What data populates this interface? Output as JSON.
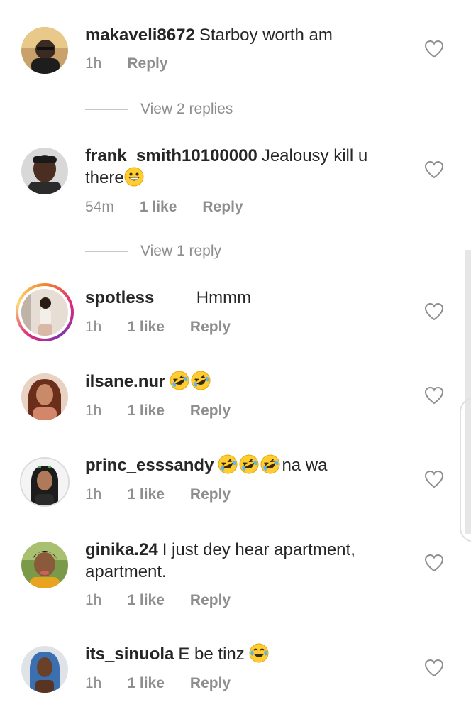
{
  "comments": [
    {
      "username": "makaveli8672",
      "text": "Starboy worth am",
      "time": "1h",
      "likes": "",
      "reply": "Reply",
      "view_replies": "View 2 replies"
    },
    {
      "username": "frank_smith10100000",
      "text": "Jealousy kill u there",
      "emoji": "grinning-face",
      "time": "54m",
      "likes": "1 like",
      "reply": "Reply",
      "view_replies": "View 1 reply"
    },
    {
      "username": "spotless____",
      "text": "Hmmm",
      "time": "1h",
      "likes": "1 like",
      "reply": "Reply"
    },
    {
      "username": "ilsane.nur",
      "text": "",
      "emoji": "rolling-on-floor-laughing x2",
      "time": "1h",
      "likes": "1 like",
      "reply": "Reply"
    },
    {
      "username": "princ_esssandy",
      "text": "na wa",
      "emoji": "rolling-on-floor-laughing x3",
      "time": "1h",
      "likes": "1 like",
      "reply": "Reply"
    },
    {
      "username": "ginika.24",
      "text": "I just dey hear apartment, apartment.",
      "time": "1h",
      "likes": "1 like",
      "reply": "Reply"
    },
    {
      "username": "its_sinuola",
      "text": "E be tinz",
      "emoji": "face-with-tears-of-joy",
      "time": "1h",
      "likes": "1 like",
      "reply": "Reply"
    }
  ],
  "icons": {
    "heart": "heart-outline-icon"
  },
  "colors": {
    "text": "#262626",
    "muted": "#8e8e8e",
    "story_ring_start": "#f58529",
    "story_ring_end": "#dd2a7b"
  }
}
